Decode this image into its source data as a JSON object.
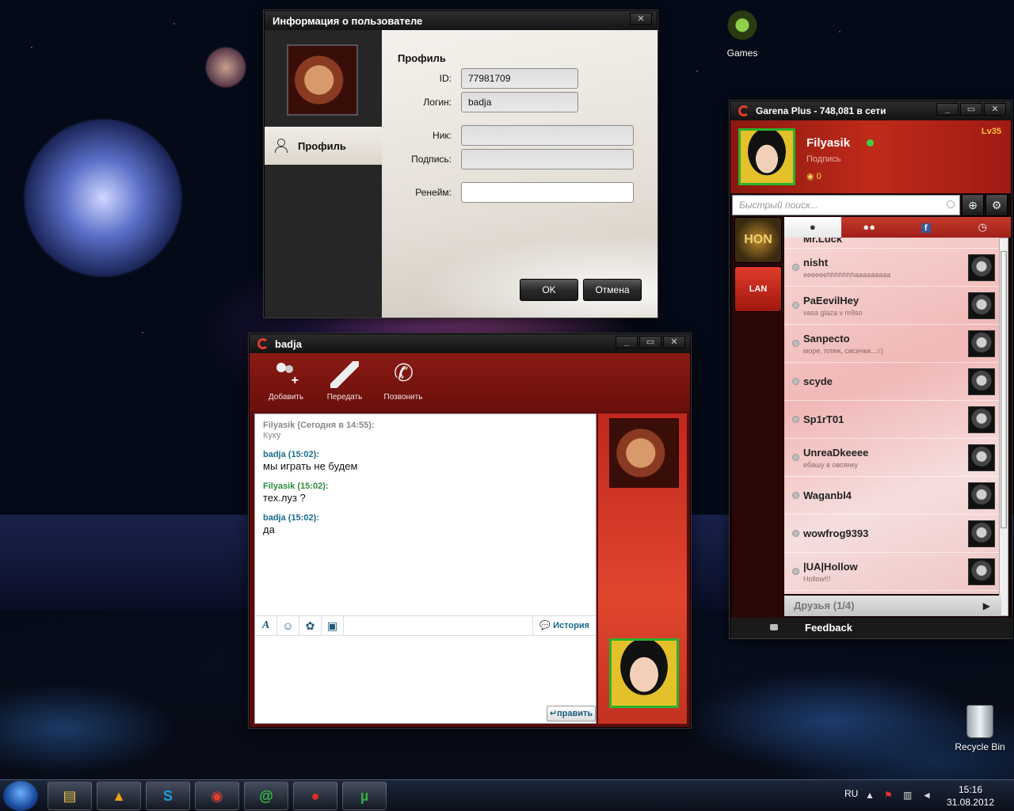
{
  "desktop": {
    "games_label": "Games",
    "bin_label": "Recycle Bin"
  },
  "dialog": {
    "title": "Информация о пользователе",
    "nav_label": "Профиль",
    "section": "Профиль",
    "id_label": "ID:",
    "id_value": "77981709",
    "login_label": "Логин:",
    "login_value": "badja",
    "nick_label": "Ник:",
    "nick_value": "",
    "sig_label": "Подпись:",
    "sig_value": "",
    "rename_label": "Ренейм:",
    "rename_value": "",
    "ok": "OK",
    "cancel": "Отмена"
  },
  "chat": {
    "title": "badja",
    "tool_add": "Добавить",
    "tool_send": "Передать",
    "tool_call": "Позвонить",
    "history": "История",
    "send": "править",
    "messages": [
      {
        "header": "Filyasik  (Сегодня в 14:55):",
        "text": "Куку"
      },
      {
        "header": "badja  (15:02):",
        "text": "мы играть не будем"
      },
      {
        "header": "Filyasik  (15:02):",
        "text": "тех.луз ?"
      },
      {
        "header": "badja  (15:02):",
        "text": "да"
      }
    ]
  },
  "main": {
    "title": "Garena Plus - 748,081 в сети",
    "user": "Filyasik",
    "signature": "Подпись",
    "shells": "0",
    "level": "Lv35",
    "search_placeholder": "Быстрый поиск...",
    "app_hon": "HON",
    "app_lan": "LAN",
    "friends": [
      {
        "name": "Mr.Luck",
        "sig": ""
      },
      {
        "name": "nisht",
        "sig": "eeeeeehhhhhhhaaaaaaaaa"
      },
      {
        "name": "PaEevilHey",
        "sig": "vasa glaza v m9so"
      },
      {
        "name": "Sanpecto",
        "sig": "море, пляж, сисички...=)"
      },
      {
        "name": "scyde",
        "sig": ""
      },
      {
        "name": "Sp1rT01",
        "sig": ""
      },
      {
        "name": "UnreaDkeeee",
        "sig": "ебашу в овсянку"
      },
      {
        "name": "Waganbl4",
        "sig": ""
      },
      {
        "name": "wowfrog9393",
        "sig": ""
      },
      {
        "name": "|UA|Hollow",
        "sig": "Hollow!!!"
      }
    ],
    "group": "Друзья (1/4)",
    "feedback": "Feedback"
  },
  "taskbar": {
    "lang": "RU",
    "time": "15:16",
    "date": "31.08.2012"
  },
  "colors": {
    "accent_red": "#c02a1a",
    "online_green": "#3fd03f",
    "level_gold": "#f5c030"
  }
}
